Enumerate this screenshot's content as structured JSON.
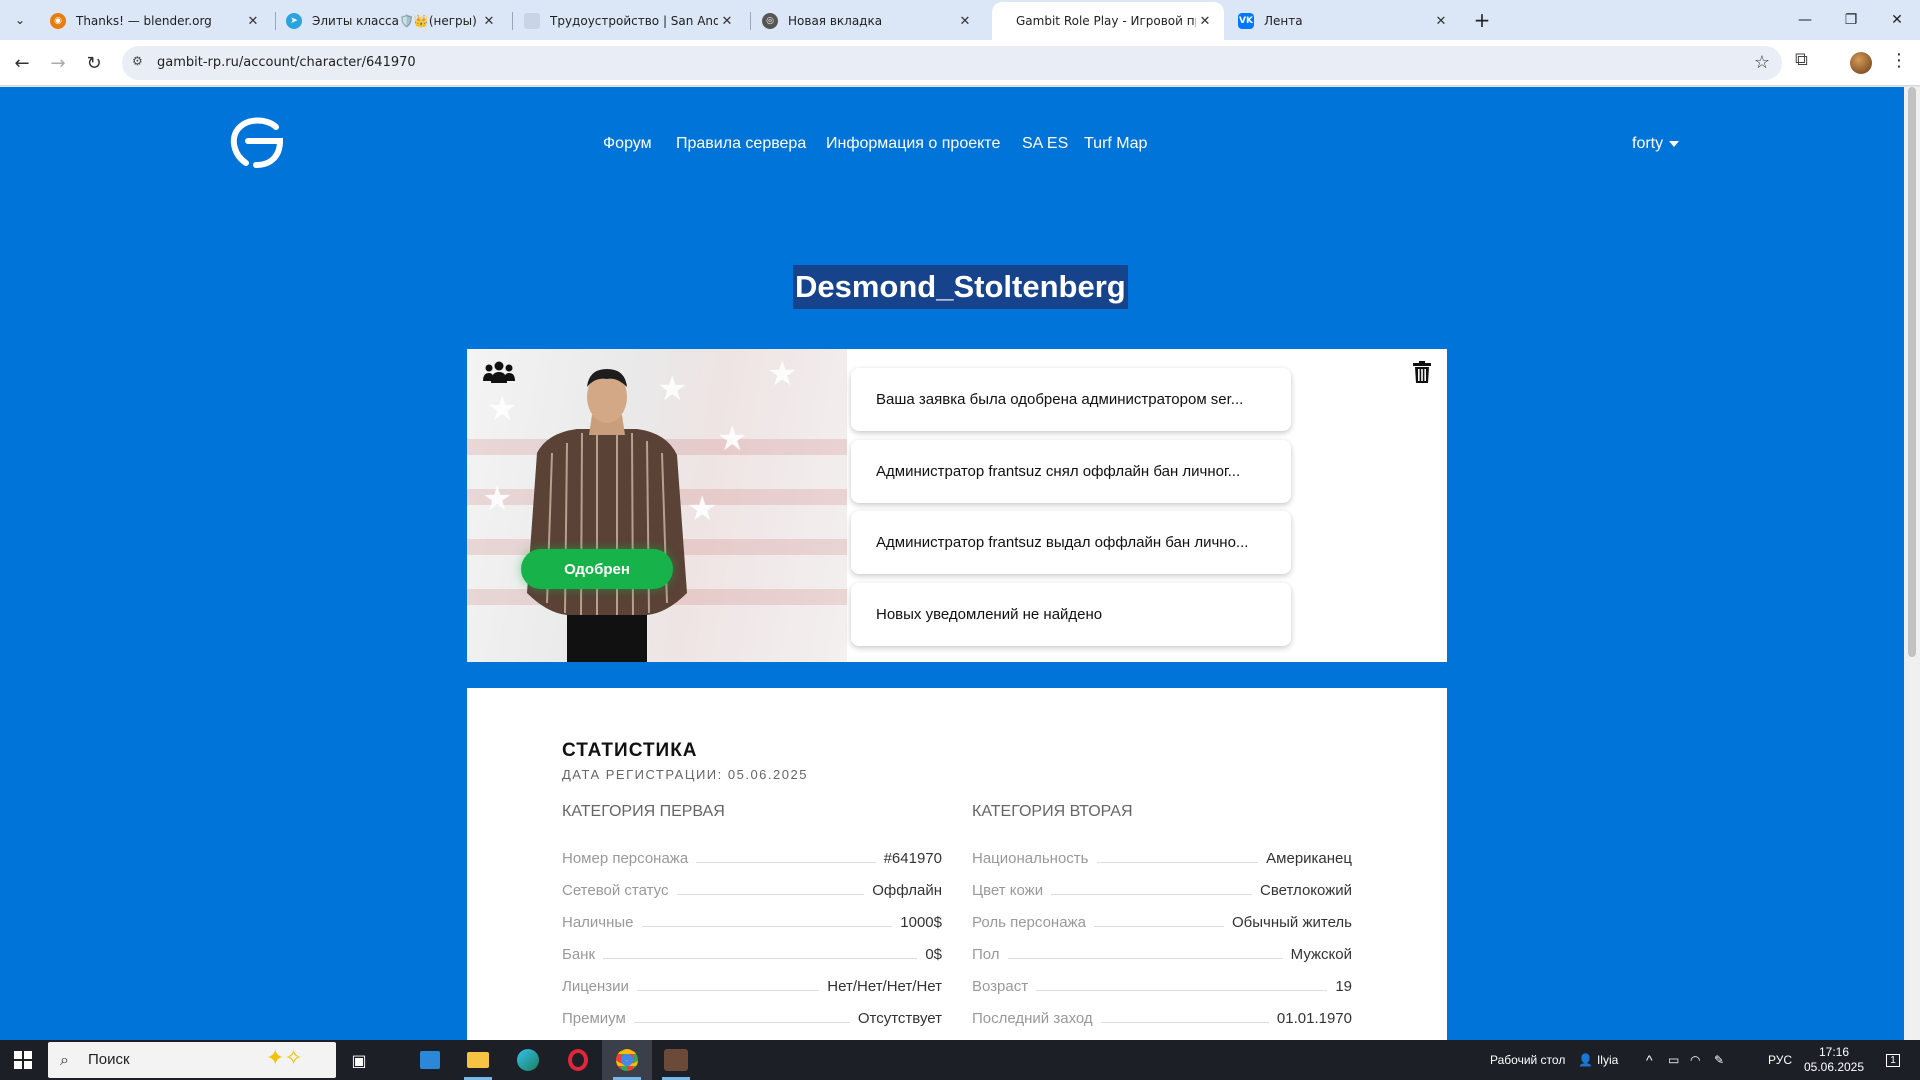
{
  "browser": {
    "tabs": [
      {
        "title": "Thanks! — blender.org",
        "favicon": "blender-icon",
        "color": "#e87d0d"
      },
      {
        "title": "Элиты класса🛡️👑(негры)",
        "favicon": "telegram-icon",
        "color": "#2aa3df"
      },
      {
        "title": "Трудоустройство | San Andreas",
        "favicon": "generic-site-icon",
        "color": "#c9d5e6"
      },
      {
        "title": "Новая вкладка",
        "favicon": "chrome-icon",
        "color": "#555555"
      },
      {
        "title": "Gambit Role Play - Игровой пр",
        "favicon": "none",
        "color": "#ffffff"
      },
      {
        "title": "Лента",
        "favicon": "vk-icon",
        "color": "#0077ff"
      }
    ],
    "url": "gambit-rp.ru/account/character/641970"
  },
  "site": {
    "nav": [
      "Форум",
      "Правила сервера",
      "Информация о проекте",
      "SA ES",
      "Turf Map"
    ],
    "user": "forty",
    "accent": "#0074d9"
  },
  "character": {
    "name": "Desmond_Stoltenberg",
    "status_badge": "Одобрен",
    "notifications": [
      "Ваша заявка была одобрена администратором ser...",
      "Администратор frantsuz снял оффлайн бан личног...",
      "Администратор frantsuz выдал оффлайн бан лично...",
      "Новых уведомлений не найдено"
    ]
  },
  "stats": {
    "title": "СТАТИСТИКА",
    "registration": "ДАТА РЕГИСТРАЦИИ: 05.06.2025",
    "cat1": {
      "title": "КАТЕГОРИЯ ПЕРВАЯ",
      "rows": [
        {
          "k": "Номер персонажа",
          "v": "#641970"
        },
        {
          "k": "Сетевой статус",
          "v": "Оффлайн"
        },
        {
          "k": "Наличные",
          "v": "1000$"
        },
        {
          "k": "Банк",
          "v": "0$"
        },
        {
          "k": "Лицензии",
          "v": "Нет/Нет/Нет/Нет"
        },
        {
          "k": "Премиум",
          "v": "Отсутствует"
        }
      ]
    },
    "cat2": {
      "title": "КАТЕГОРИЯ ВТОРАЯ",
      "rows": [
        {
          "k": "Национальность",
          "v": "Американец"
        },
        {
          "k": "Цвет кожи",
          "v": "Светлокожий"
        },
        {
          "k": "Роль персонажа",
          "v": "Обычный житель"
        },
        {
          "k": "Пол",
          "v": "Мужской"
        },
        {
          "k": "Возраст",
          "v": "19"
        },
        {
          "k": "Последний заход",
          "v": "01.01.1970"
        }
      ]
    }
  },
  "taskbar": {
    "search_placeholder": "Поиск",
    "desktop_label": "Рабочий стол",
    "user_label": "Ilyia",
    "lang": "РУС",
    "time": "17:16",
    "date": "05.06.2025",
    "notification_count": "1"
  }
}
